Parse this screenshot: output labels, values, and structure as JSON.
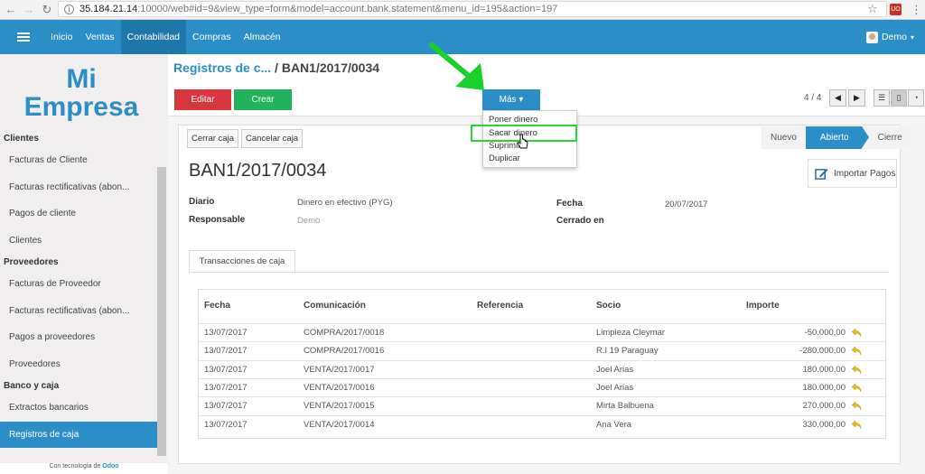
{
  "browser": {
    "url_host": "35.184.21.14",
    "url_rest": ":10000/web#id=9&view_type=form&model=account.bank.statement&menu_id=195&action=197"
  },
  "topnav": {
    "items": [
      "Inicio",
      "Ventas",
      "Contabilidad",
      "Compras",
      "Almacén"
    ],
    "active": "Contabilidad",
    "user": "Demo"
  },
  "sidebar": {
    "logo_line1": "Mi",
    "logo_line2": "Empresa",
    "entries": [
      {
        "type": "cat",
        "label": "Clientes"
      },
      {
        "type": "item",
        "label": "Facturas de Cliente"
      },
      {
        "type": "item",
        "label": "Facturas rectificativas (abon..."
      },
      {
        "type": "item",
        "label": "Pagos de cliente"
      },
      {
        "type": "item",
        "label": "Clientes"
      },
      {
        "type": "cat",
        "label": "Proveedores"
      },
      {
        "type": "item",
        "label": "Facturas de Proveedor"
      },
      {
        "type": "item",
        "label": "Facturas rectificativas (abon..."
      },
      {
        "type": "item",
        "label": "Pagos a proveedores"
      },
      {
        "type": "item",
        "label": "Proveedores"
      },
      {
        "type": "cat",
        "label": "Banco y caja"
      },
      {
        "type": "item",
        "label": "Extractos bancarios"
      },
      {
        "type": "item",
        "label": "Registros de caja",
        "active": true
      }
    ],
    "powered_prefix": "Con tecnología de",
    "powered_brand": "Odoo"
  },
  "header": {
    "breadcrumb_link": "Registros de c...",
    "breadcrumb_sep": " / ",
    "breadcrumb_current": "BAN1/2017/0034",
    "edit": "Editar",
    "create": "Crear",
    "more": "Más ▾",
    "pager": "4 / 4"
  },
  "more_menu": [
    "Poner dinero",
    "Sacar dinero",
    "Suprimir",
    "Duplicar"
  ],
  "form": {
    "actions": [
      "Cerrar caja",
      "Cancelar caja"
    ],
    "stages": [
      "Nuevo",
      "Abierto",
      "Cierre"
    ],
    "active_stage": "Abierto",
    "title": "BAN1/2017/0034",
    "import_button": "Importar Pagos",
    "fields": {
      "diario_label": "Diario",
      "diario_value": "Dinero en efectivo (PYG)",
      "responsable_label": "Responsable",
      "responsable_value": "Demo",
      "fecha_label": "Fecha",
      "fecha_value": "20/07/2017",
      "cerrado_label": "Cerrado en"
    },
    "tab": "Transacciones de caja"
  },
  "table": {
    "headers": [
      "Fecha",
      "Comunicación",
      "Referencia",
      "Socio",
      "Importe"
    ],
    "rows": [
      {
        "fecha": "13/07/2017",
        "comunicacion": "COMPRA/2017/0018",
        "referencia": "",
        "socio": "Limpieza Cleymar",
        "importe": "-50.000,00"
      },
      {
        "fecha": "13/07/2017",
        "comunicacion": "COMPRA/2017/0016",
        "referencia": "",
        "socio": "R.I 19 Paraguay",
        "importe": "-280.000,00"
      },
      {
        "fecha": "13/07/2017",
        "comunicacion": "VENTA/2017/0017",
        "referencia": "",
        "socio": "Joel Arias",
        "importe": "180.000,00"
      },
      {
        "fecha": "13/07/2017",
        "comunicacion": "VENTA/2017/0016",
        "referencia": "",
        "socio": "Joel Arias",
        "importe": "180.000,00"
      },
      {
        "fecha": "13/07/2017",
        "comunicacion": "VENTA/2017/0015",
        "referencia": "",
        "socio": "Mirta Balbuena",
        "importe": "270.000,00"
      },
      {
        "fecha": "13/07/2017",
        "comunicacion": "VENTA/2017/0014",
        "referencia": "",
        "socio": "Ana Vera",
        "importe": "330.000,00"
      }
    ]
  },
  "colors": {
    "brand": "#2c8ec6",
    "edit": "#d9363e",
    "create": "#21b35b",
    "highlight": "#29d236",
    "undo_icon": "#e0c11a"
  },
  "icons": [
    "back-icon",
    "forward-icon",
    "reload-icon",
    "info-icon",
    "star-icon",
    "hamburger-icon",
    "undo-icon",
    "edit-icon",
    "cursor-icon",
    "arrow-annotation"
  ]
}
